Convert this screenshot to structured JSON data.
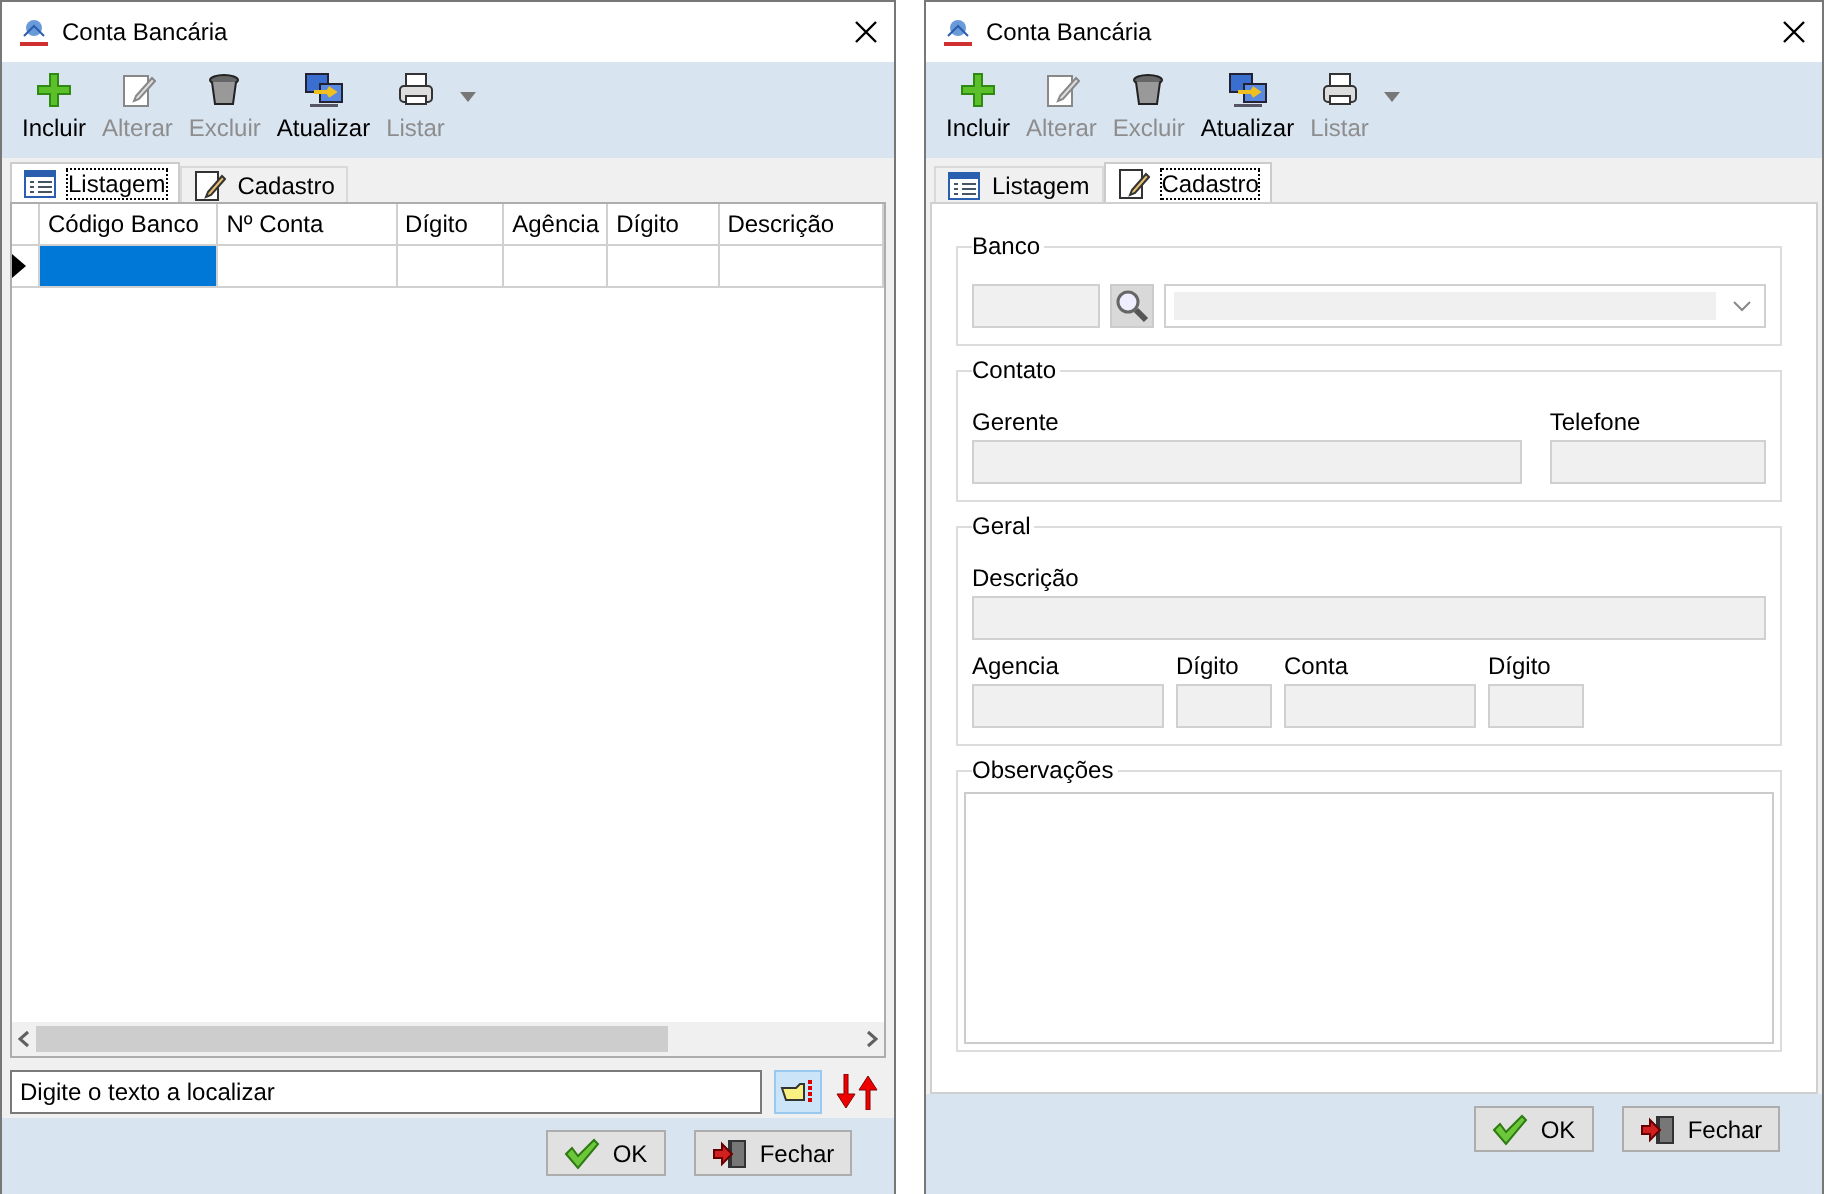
{
  "windows": [
    {
      "title": "Conta Bancária",
      "toolbar": [
        {
          "kind": "add",
          "label": "Incluir",
          "disabled": false
        },
        {
          "kind": "edit",
          "label": "Alterar",
          "disabled": true
        },
        {
          "kind": "delete",
          "label": "Excluir",
          "disabled": true
        },
        {
          "kind": "refresh",
          "label": "Atualizar",
          "disabled": false
        },
        {
          "kind": "print",
          "label": "Listar",
          "disabled": true
        }
      ],
      "tabs": [
        {
          "kind": "list",
          "label": "Listagem",
          "selected": true
        },
        {
          "kind": "form",
          "label": "Cadastro",
          "selected": false
        }
      ],
      "content": {
        "kind": "grid",
        "columns": [
          "Código Banco",
          "Nº Conta",
          "Dígito",
          "Agência",
          "Dígito",
          "Descrição"
        ],
        "rows": [
          {
            "selected": true
          }
        ],
        "search": {
          "value": "Digite o texto a localizar"
        }
      },
      "buttons": [
        {
          "kind": "ok",
          "label": "OK"
        },
        {
          "kind": "close",
          "label": "Fechar"
        }
      ]
    },
    {
      "title": "Conta Bancária",
      "toolbar": [
        {
          "kind": "add",
          "label": "Incluir",
          "disabled": false
        },
        {
          "kind": "edit",
          "label": "Alterar",
          "disabled": true
        },
        {
          "kind": "delete",
          "label": "Excluir",
          "disabled": true
        },
        {
          "kind": "refresh",
          "label": "Atualizar",
          "disabled": false
        },
        {
          "kind": "print",
          "label": "Listar",
          "disabled": true
        }
      ],
      "tabs": [
        {
          "kind": "list",
          "label": "Listagem",
          "selected": false
        },
        {
          "kind": "form",
          "label": "Cadastro",
          "selected": true
        }
      ],
      "content": {
        "kind": "form",
        "groups": [
          {
            "kind": "lookup",
            "title": "Banco"
          },
          {
            "kind": "fields",
            "title": "Contato",
            "rows": [
              [
                {
                  "label": "Gerente"
                },
                {
                  "label": "Telefone"
                }
              ]
            ]
          },
          {
            "kind": "fields",
            "title": "Geral",
            "rows": [
              [
                {
                  "label": "Descrição"
                }
              ],
              [
                {
                  "label": "Agencia"
                },
                {
                  "label": "Dígito"
                },
                {
                  "label": "Conta"
                },
                {
                  "label": "Dígito"
                }
              ]
            ]
          },
          {
            "kind": "memo",
            "title": "Observações"
          }
        ]
      },
      "buttons": [
        {
          "kind": "ok",
          "label": "OK"
        },
        {
          "kind": "close",
          "label": "Fechar"
        }
      ]
    }
  ]
}
